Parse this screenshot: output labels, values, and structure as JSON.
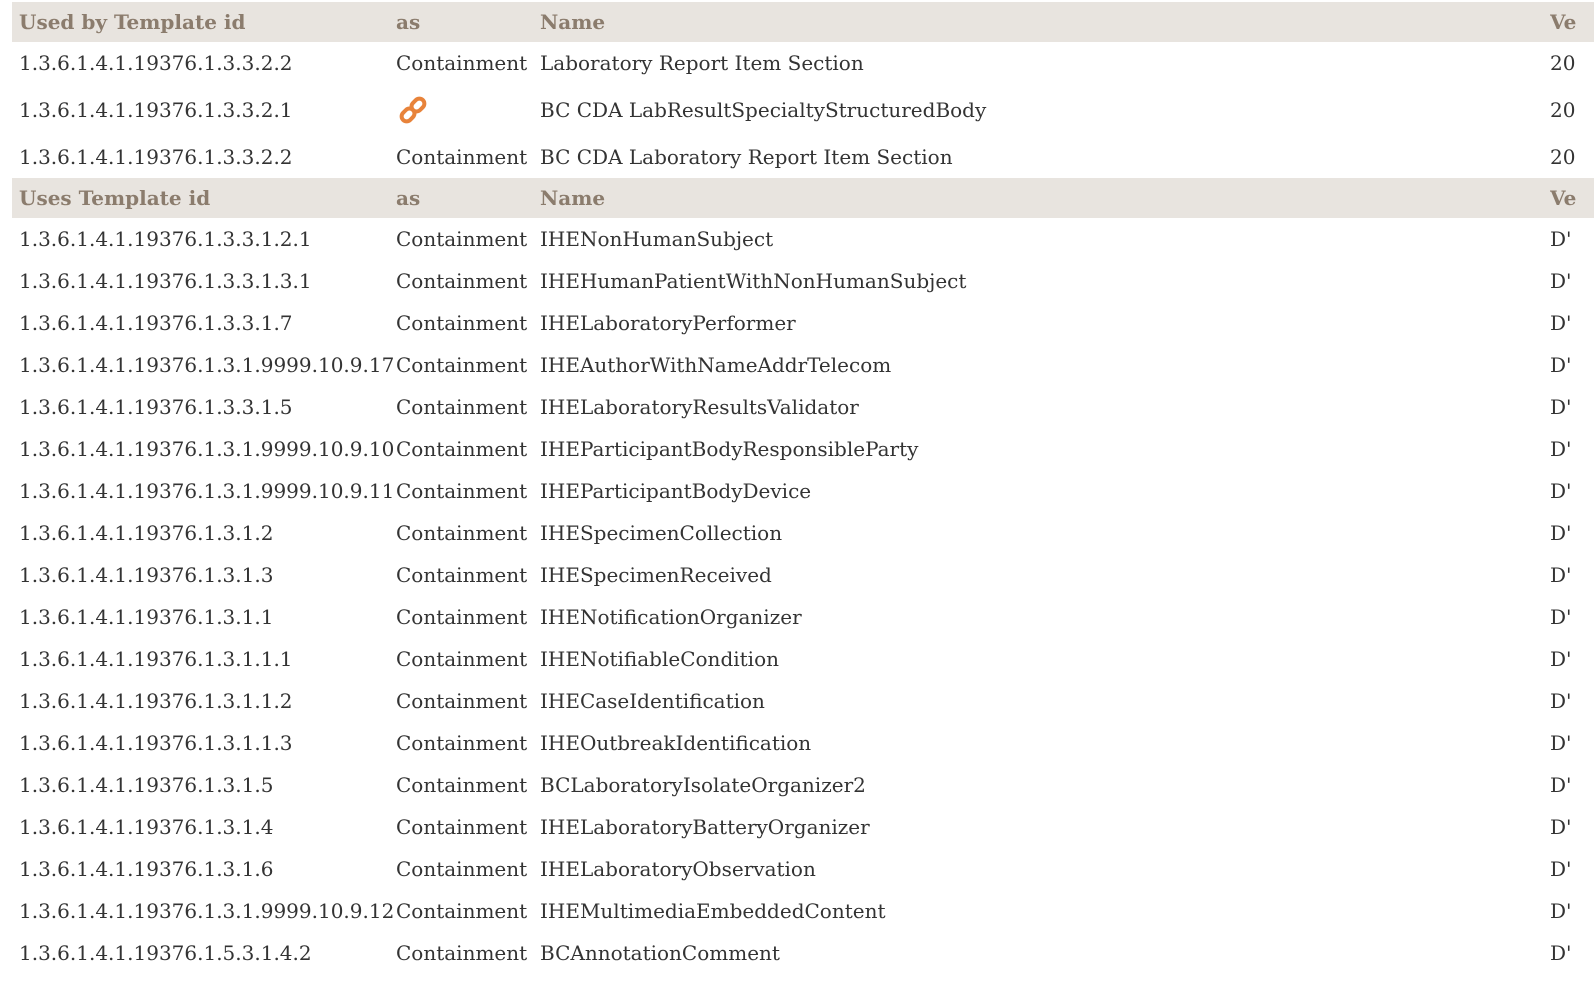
{
  "used_by": {
    "headers": [
      "Used by Template id",
      "as",
      "Name",
      "Ve"
    ],
    "rows": [
      {
        "id": "1.3.6.1.4.1.19376.1.3.3.2.2",
        "as": "Containment",
        "name": "Laboratory Report Item Section",
        "version": "20"
      },
      {
        "id": "1.3.6.1.4.1.19376.1.3.3.2.1",
        "as_icon": "link-icon",
        "name": "BC CDA LabResultSpecialtyStructuredBody",
        "version": "20"
      },
      {
        "id": "1.3.6.1.4.1.19376.1.3.3.2.2",
        "as": "Containment",
        "name": "BC CDA Laboratory Report Item Section",
        "version": "20"
      }
    ]
  },
  "uses": {
    "headers": [
      "Uses Template id",
      "as",
      "Name",
      "Ve"
    ],
    "rows": [
      {
        "id": "1.3.6.1.4.1.19376.1.3.3.1.2.1",
        "as": "Containment",
        "name": "IHENonHumanSubject",
        "version": "D'"
      },
      {
        "id": "1.3.6.1.4.1.19376.1.3.3.1.3.1",
        "as": "Containment",
        "name": "IHEHumanPatientWithNonHumanSubject",
        "version": "D'"
      },
      {
        "id": "1.3.6.1.4.1.19376.1.3.3.1.7",
        "as": "Containment",
        "name": "IHELaboratoryPerformer",
        "version": "D'"
      },
      {
        "id": "1.3.6.1.4.1.19376.1.3.1.9999.10.9.17",
        "as": "Containment",
        "name": "IHEAuthorWithNameAddrTelecom",
        "version": "D'"
      },
      {
        "id": "1.3.6.1.4.1.19376.1.3.3.1.5",
        "as": "Containment",
        "name": "IHELaboratoryResultsValidator",
        "version": "D'"
      },
      {
        "id": "1.3.6.1.4.1.19376.1.3.1.9999.10.9.10",
        "as": "Containment",
        "name": "IHEParticipantBodyResponsibleParty",
        "version": "D'"
      },
      {
        "id": "1.3.6.1.4.1.19376.1.3.1.9999.10.9.11",
        "as": "Containment",
        "name": "IHEParticipantBodyDevice",
        "version": "D'"
      },
      {
        "id": "1.3.6.1.4.1.19376.1.3.1.2",
        "as": "Containment",
        "name": "IHESpecimenCollection",
        "version": "D'"
      },
      {
        "id": "1.3.6.1.4.1.19376.1.3.1.3",
        "as": "Containment",
        "name": "IHESpecimenReceived",
        "version": "D'"
      },
      {
        "id": "1.3.6.1.4.1.19376.1.3.1.1",
        "as": "Containment",
        "name": "IHENotificationOrganizer",
        "version": "D'"
      },
      {
        "id": "1.3.6.1.4.1.19376.1.3.1.1.1",
        "as": "Containment",
        "name": "IHENotifiableCondition",
        "version": "D'"
      },
      {
        "id": "1.3.6.1.4.1.19376.1.3.1.1.2",
        "as": "Containment",
        "name": "IHECaseIdentification",
        "version": "D'"
      },
      {
        "id": "1.3.6.1.4.1.19376.1.3.1.1.3",
        "as": "Containment",
        "name": "IHEOutbreakIdentification",
        "version": "D'"
      },
      {
        "id": "1.3.6.1.4.1.19376.1.3.1.5",
        "as": "Containment",
        "name": "BCLaboratoryIsolateOrganizer2",
        "version": "D'"
      },
      {
        "id": "1.3.6.1.4.1.19376.1.3.1.4",
        "as": "Containment",
        "name": "IHELaboratoryBatteryOrganizer",
        "version": "D'"
      },
      {
        "id": "1.3.6.1.4.1.19376.1.3.1.6",
        "as": "Containment",
        "name": "IHELaboratoryObservation",
        "version": "D'"
      },
      {
        "id": "1.3.6.1.4.1.19376.1.3.1.9999.10.9.12",
        "as": "Containment",
        "name": "IHEMultimediaEmbeddedContent",
        "version": "D'"
      },
      {
        "id": "1.3.6.1.4.1.19376.1.5.3.1.4.2",
        "as": "Containment",
        "name": "BCAnnotationComment",
        "version": "D'"
      }
    ]
  },
  "colors": {
    "header_bg": "#e8e4df",
    "header_text": "#8b7c6d",
    "body_text": "#333333",
    "link_icon": "#e8833a"
  }
}
